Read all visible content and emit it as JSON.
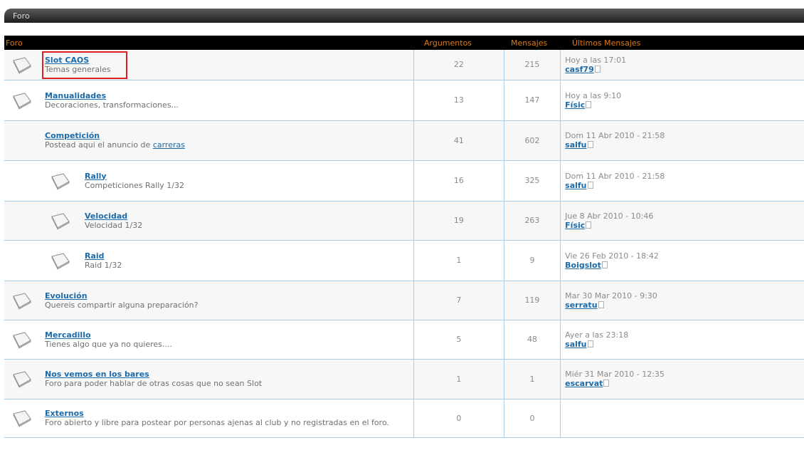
{
  "category": {
    "title": "Foro"
  },
  "header": {
    "forum": "Foro",
    "topics": "Argumentos",
    "posts": "Mensajes",
    "last": "Últimos Mensajes"
  },
  "forums": [
    {
      "name": "Slot CAOS",
      "desc": "Temas generales",
      "topics": "22",
      "posts": "215",
      "last_date": "Hoy a las 17:01",
      "last_user": "casf79",
      "sub": false,
      "icon": true
    },
    {
      "name": "Manualidades",
      "desc": "Decoraciones, transformaciones...",
      "topics": "13",
      "posts": "147",
      "last_date": "Hoy a las 9:10",
      "last_user": "Físic",
      "sub": false,
      "icon": true
    },
    {
      "name": "Competición",
      "desc_pre": "Postead aqui el anuncio de ",
      "desc_link": "carreras",
      "topics": "41",
      "posts": "602",
      "last_date": "Dom 11 Abr 2010 - 21:58",
      "last_user": "salfu",
      "sub": false,
      "icon": false
    },
    {
      "name": "Rally",
      "desc": "Competiciones Rally 1/32",
      "topics": "16",
      "posts": "325",
      "last_date": "Dom 11 Abr 2010 - 21:58",
      "last_user": "salfu",
      "sub": true,
      "icon": true
    },
    {
      "name": "Velocidad",
      "desc": "Velocidad 1/32",
      "topics": "19",
      "posts": "263",
      "last_date": "Jue 8 Abr 2010 - 10:46",
      "last_user": "Físic",
      "sub": true,
      "icon": true
    },
    {
      "name": "Raid",
      "desc": "Raid 1/32",
      "topics": "1",
      "posts": "9",
      "last_date": "Vie 26 Feb 2010 - 18:42",
      "last_user": "Boigslot",
      "sub": true,
      "icon": true
    },
    {
      "name": "Evolución",
      "desc": "Quereis compartir alguna preparación?",
      "topics": "7",
      "posts": "119",
      "last_date": "Mar 30 Mar 2010 - 9:30",
      "last_user": "serratu",
      "sub": false,
      "icon": true
    },
    {
      "name": "Mercadillo",
      "desc": "Tienes algo que ya no quieres....",
      "topics": "5",
      "posts": "48",
      "last_date": "Ayer a las 23:18",
      "last_user": "salfu",
      "sub": false,
      "icon": true
    },
    {
      "name": "Nos vemos en los bares",
      "desc": "Foro para poder hablar de otras cosas que no sean Slot",
      "topics": "1",
      "posts": "1",
      "last_date": "Miér 31 Mar 2010 - 12:35",
      "last_user": "escarvat",
      "sub": false,
      "icon": true
    },
    {
      "name": "Externos",
      "desc": "Foro abierto y libre para postear por personas ajenas al club y no registradas en el foro.",
      "topics": "0",
      "posts": "0",
      "last_date": "",
      "last_user": "",
      "sub": false,
      "icon": true
    }
  ]
}
